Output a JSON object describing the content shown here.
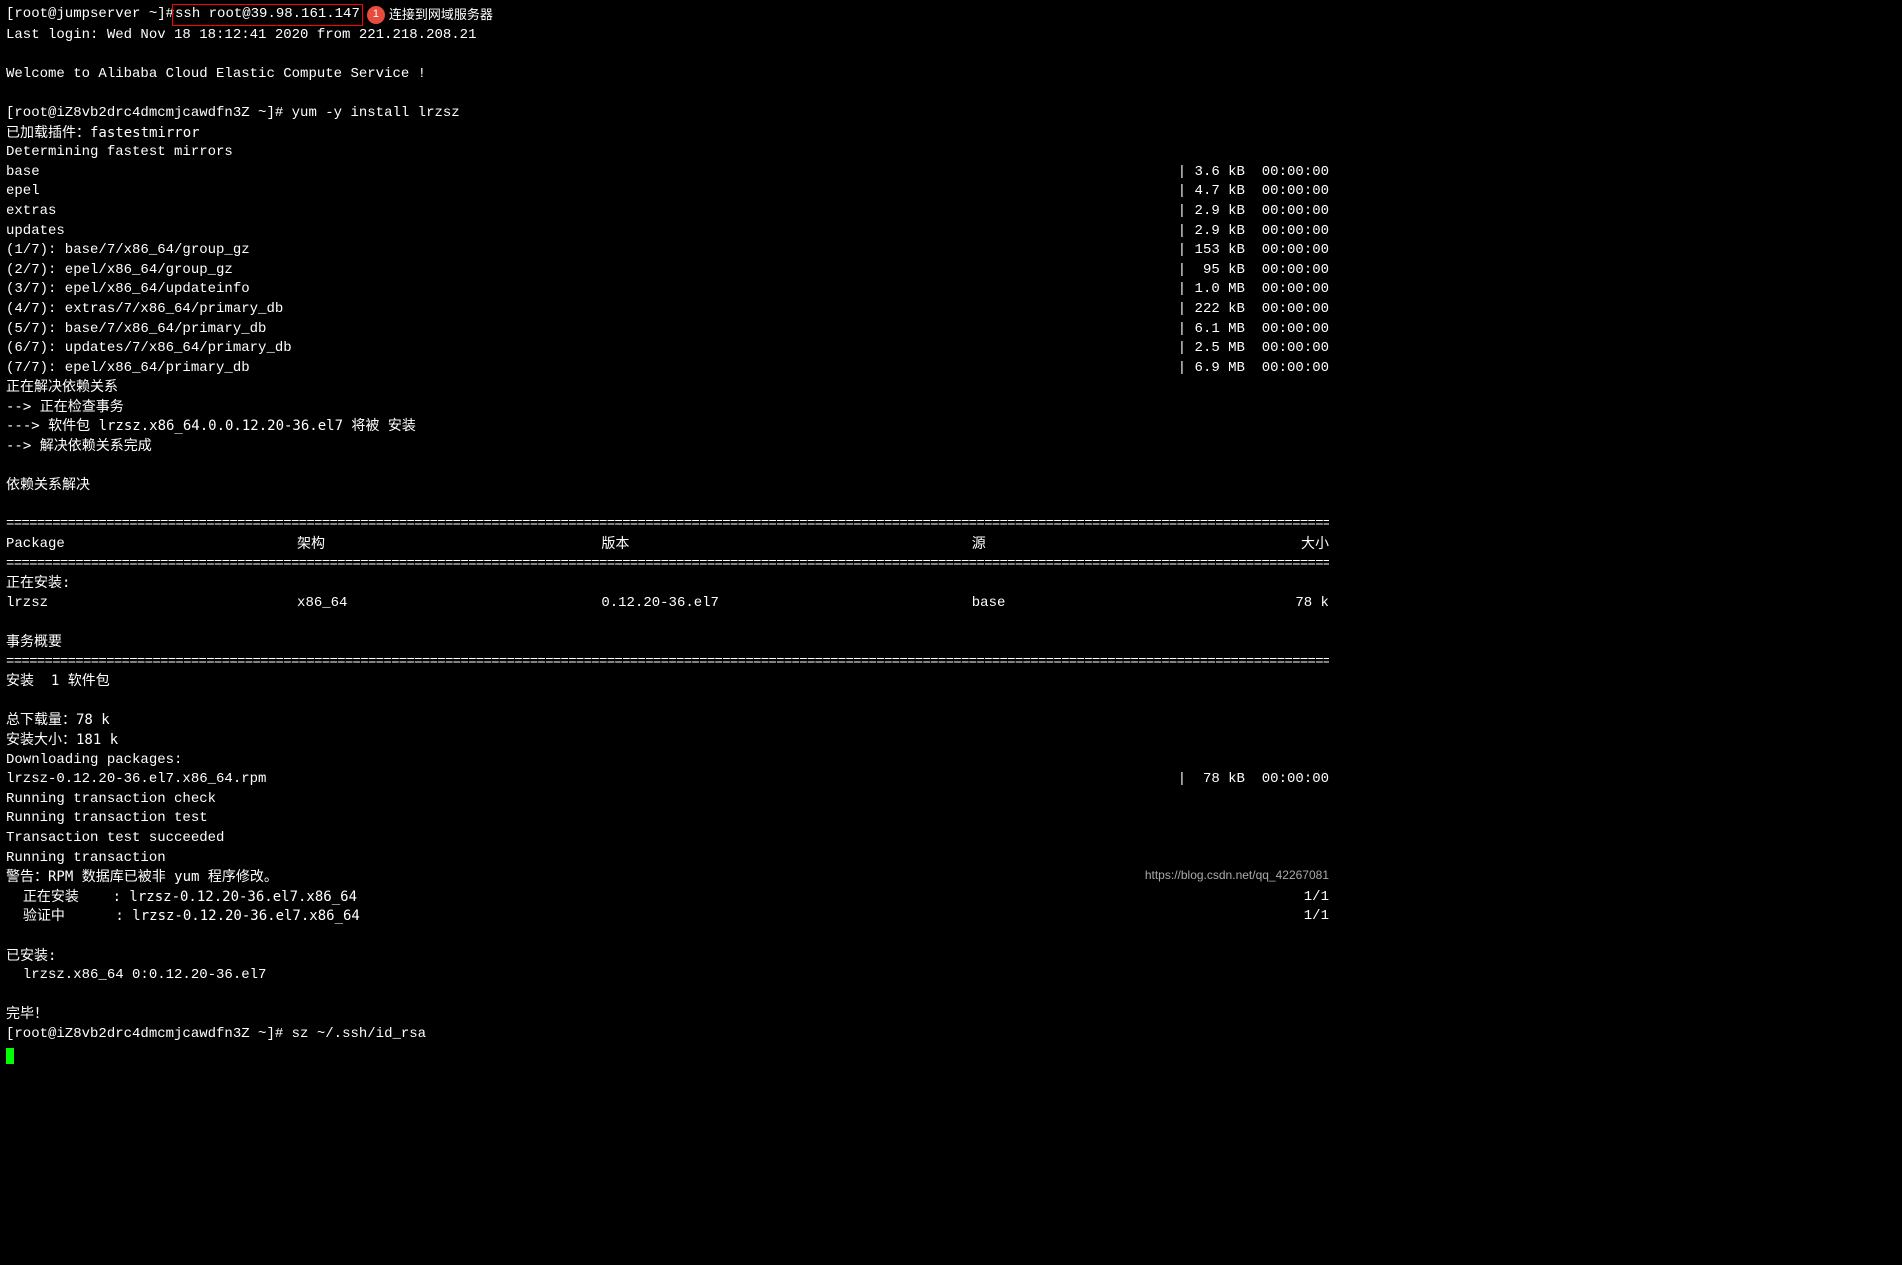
{
  "top": {
    "prompt_host": "[root@jumpserver ~]#",
    "highlighted_cmd": "  ssh  root@39.98.161.147",
    "badge": "1",
    "badge_label": "连接到网域服务器",
    "last_login": "Last login: Wed Nov 18 18:12:41 2020 from 221.218.208.21"
  },
  "welcome": "Welcome to Alibaba Cloud Elastic Compute Service !",
  "cmd2": {
    "prompt": "[root@iZ8vb2drc4dmcmjcawdfn3Z ~]# ",
    "cmd": "yum -y install lrzsz"
  },
  "output1": [
    "已加载插件：fastestmirror",
    "Determining fastest mirrors"
  ],
  "repos": [
    {
      "name": "base",
      "size": "3.6 kB",
      "time": "00:00:00"
    },
    {
      "name": "epel",
      "size": "4.7 kB",
      "time": "00:00:00"
    },
    {
      "name": "extras",
      "size": "2.9 kB",
      "time": "00:00:00"
    },
    {
      "name": "updates",
      "size": "2.9 kB",
      "time": "00:00:00"
    },
    {
      "name": "(1/7): base/7/x86_64/group_gz",
      "size": "153 kB",
      "time": "00:00:00"
    },
    {
      "name": "(2/7): epel/x86_64/group_gz",
      "size": " 95 kB",
      "time": "00:00:00"
    },
    {
      "name": "(3/7): epel/x86_64/updateinfo",
      "size": "1.0 MB",
      "time": "00:00:00"
    },
    {
      "name": "(4/7): extras/7/x86_64/primary_db",
      "size": "222 kB",
      "time": "00:00:00"
    },
    {
      "name": "(5/7): base/7/x86_64/primary_db",
      "size": "6.1 MB",
      "time": "00:00:00"
    },
    {
      "name": "(6/7): updates/7/x86_64/primary_db",
      "size": "2.5 MB",
      "time": "00:00:00"
    },
    {
      "name": "(7/7): epel/x86_64/primary_db",
      "size": "6.9 MB",
      "time": "00:00:00"
    }
  ],
  "resolve": [
    "正在解决依赖关系",
    "--> 正在检查事务",
    "---> 软件包 lrzsz.x86_64.0.0.12.20-36.el7 将被 安装",
    "--> 解决依赖关系完成"
  ],
  "deps_resolved": "依赖关系解决",
  "table_header": {
    "pkg": " Package",
    "arch": "架构",
    "ver": "版本",
    "repo": "源",
    "size": "大小"
  },
  "installing_label": "正在安装:",
  "pkg_row": {
    "pkg": " lrzsz",
    "arch": "x86_64",
    "ver": "0.12.20-36.el7",
    "repo": "base",
    "size": "78 k"
  },
  "summary_label": "事务概要",
  "install_count": "安装  1 软件包",
  "download_size": "总下载量：78 k",
  "install_size": "安装大小：181 k",
  "downloading": "Downloading packages:",
  "rpm_line": {
    "name": "lrzsz-0.12.20-36.el7.x86_64.rpm",
    "size": " 78 kB",
    "time": "00:00:00"
  },
  "trans_lines": [
    "Running transaction check",
    "Running transaction test",
    "Transaction test succeeded",
    "Running transaction"
  ],
  "warning": "警告：RPM 数据库已被非 yum 程序修改。",
  "install_steps": [
    {
      "label": "  正在安装    : lrzsz-0.12.20-36.el7.x86_64",
      "frac": "1/1"
    },
    {
      "label": "  验证中      : lrzsz-0.12.20-36.el7.x86_64",
      "frac": "1/1"
    }
  ],
  "installed_label": "已安装:",
  "installed_item": "  lrzsz.x86_64 0:0.12.20-36.el7",
  "complete": "完毕！",
  "cmd3": {
    "prompt": "[root@iZ8vb2drc4dmcmjcawdfn3Z ~]# ",
    "cmd": "sz ~/.ssh/id_rsa"
  },
  "watermark": "https://blog.csdn.net/qq_42267081"
}
